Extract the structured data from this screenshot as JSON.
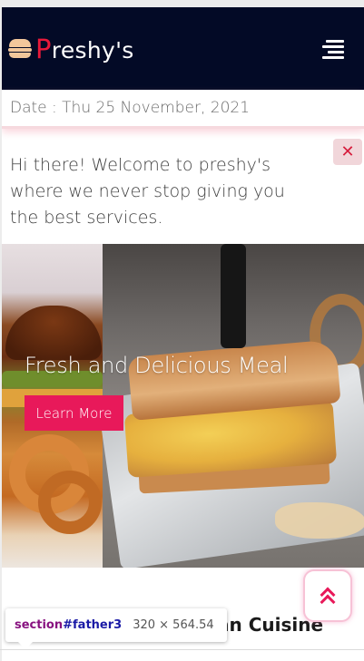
{
  "brand": {
    "icon": "burger-icon",
    "initial": "P",
    "rest": "reshy's"
  },
  "header": {
    "menu_icon": "menu-icon",
    "background": "#030a26",
    "accent": "#e8193a"
  },
  "datebar": {
    "text": "Date : Thu 25 November, 2021"
  },
  "alert": {
    "message": "Hi there! Welcome to preshy's where we never stop giving you the best services.",
    "close_label": "✕"
  },
  "hero": {
    "title": "Fresh and Delicious Meal",
    "button_label": "Learn More",
    "button_color": "#e8195a"
  },
  "section": {
    "heading": "an Cuisine"
  },
  "scroll_top": {
    "icon": "double-chevron-up-icon"
  },
  "devtools": {
    "tag": "section",
    "id": "#father3",
    "dims": "320 × 564.54"
  }
}
